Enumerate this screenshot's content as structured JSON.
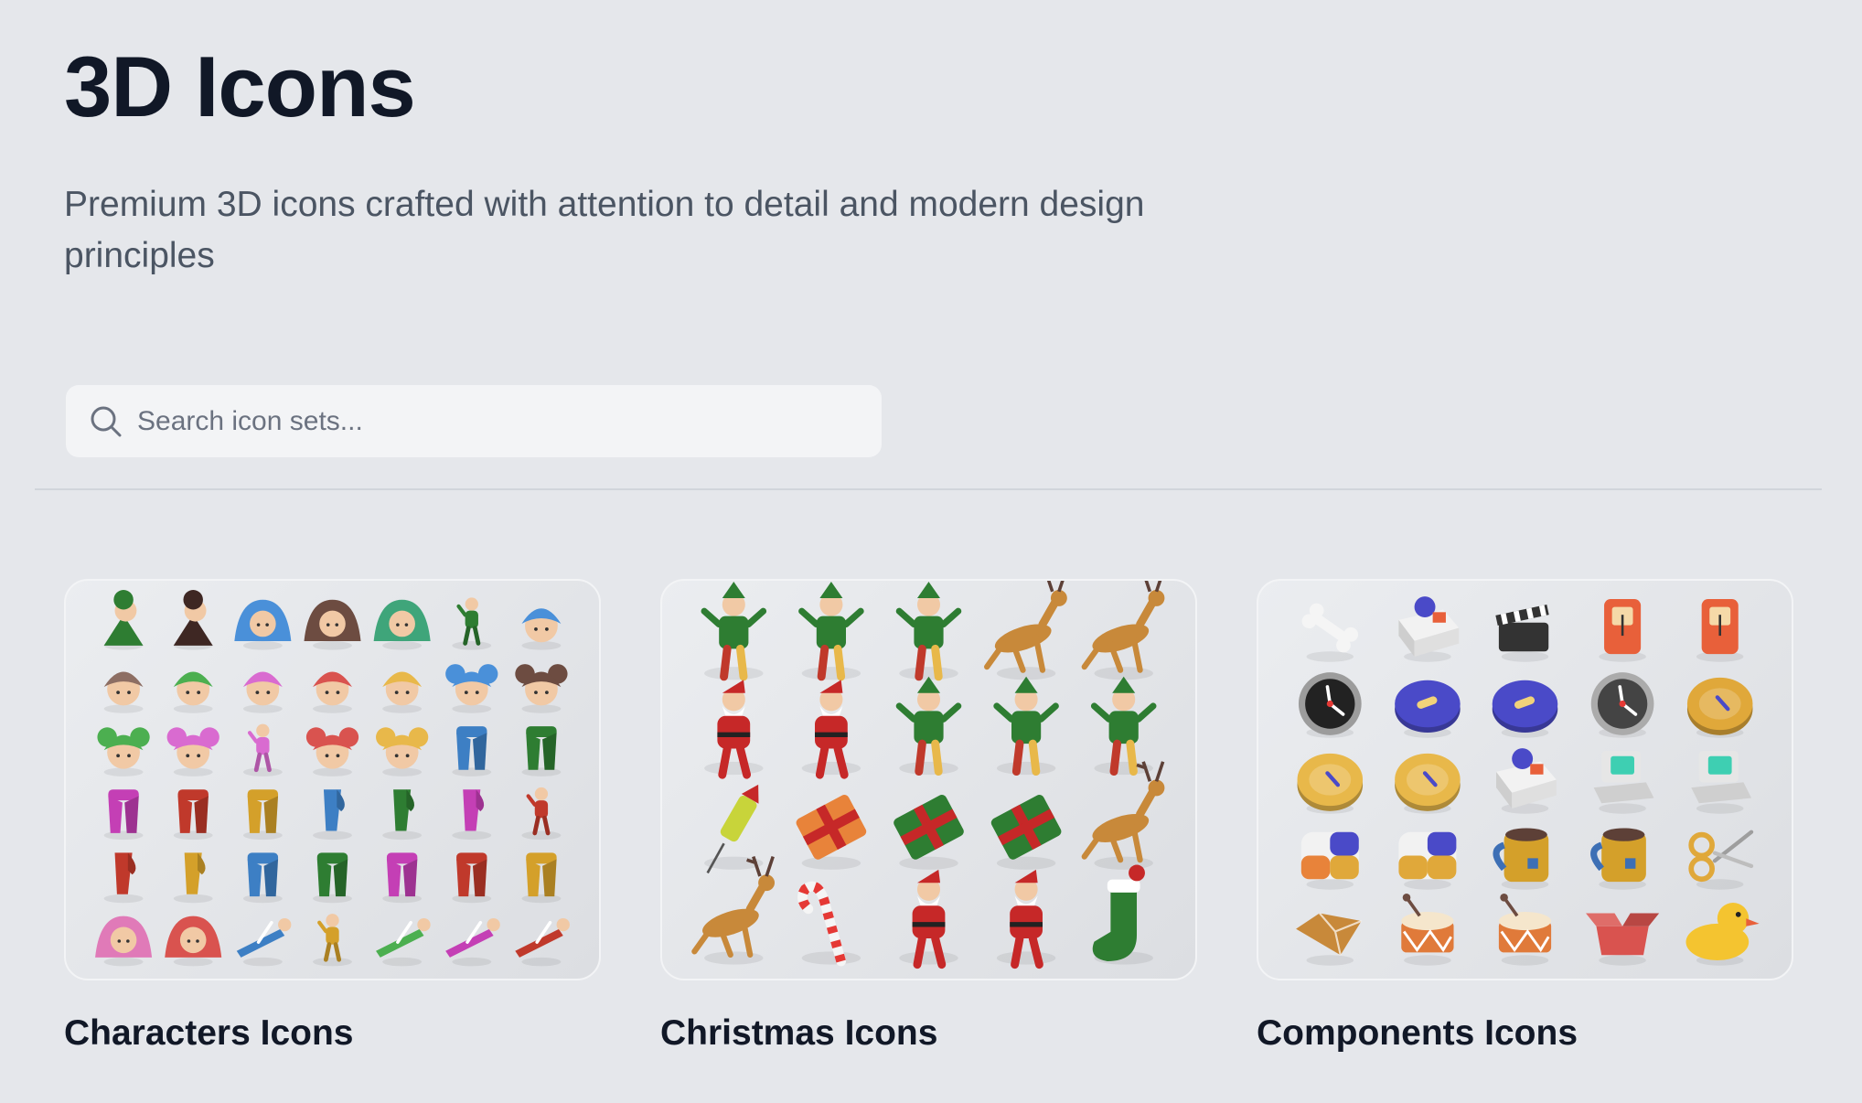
{
  "header": {
    "title": "3D Icons",
    "subtitle": "Premium 3D icons crafted with attention to detail and modern design principles"
  },
  "search": {
    "placeholder": "Search icon sets...",
    "icon": "search-icon"
  },
  "colors": {
    "background": "#e5e7eb",
    "title": "#111827",
    "subtitle": "#4b5563",
    "search_bg": "#f3f4f6"
  },
  "icon_sets": [
    {
      "name": "Characters Icons",
      "cols": 7,
      "rows": 6,
      "icons": [
        {
          "type": "elf-figure",
          "color": "#2e7d32"
        },
        {
          "type": "elf-figure",
          "color": "#3e2723"
        },
        {
          "type": "avatar",
          "color": "#4a90d9"
        },
        {
          "type": "avatar",
          "color": "#6d4c41"
        },
        {
          "type": "avatar",
          "color": "#3fa57a"
        },
        {
          "type": "figure",
          "color": "#2e7d32"
        },
        {
          "type": "head",
          "color": "#4a90d9"
        },
        {
          "type": "head",
          "color": "#8d6e63"
        },
        {
          "type": "head",
          "color": "#4caf50"
        },
        {
          "type": "head",
          "color": "#d96bd0"
        },
        {
          "type": "head",
          "color": "#d9534f"
        },
        {
          "type": "head",
          "color": "#e8b84a"
        },
        {
          "type": "bun-head",
          "color": "#4a90d9"
        },
        {
          "type": "bun-head",
          "color": "#6d4c41"
        },
        {
          "type": "bun-head",
          "color": "#4caf50"
        },
        {
          "type": "bun-head",
          "color": "#d96bd0"
        },
        {
          "type": "figure",
          "color": "#d96bd0"
        },
        {
          "type": "bun-head",
          "color": "#d9534f"
        },
        {
          "type": "bun-head",
          "color": "#e8b84a"
        },
        {
          "type": "legs",
          "color": "#3d7fc4"
        },
        {
          "type": "legs",
          "color": "#2e7d32"
        },
        {
          "type": "legs",
          "color": "#c43fb5"
        },
        {
          "type": "legs",
          "color": "#c0392b"
        },
        {
          "type": "legs",
          "color": "#d4a02a"
        },
        {
          "type": "leg",
          "color": "#3d7fc4"
        },
        {
          "type": "leg",
          "color": "#2e7d32"
        },
        {
          "type": "leg",
          "color": "#c43fb5"
        },
        {
          "type": "figure",
          "color": "#c0392b"
        },
        {
          "type": "leg",
          "color": "#c0392b"
        },
        {
          "type": "leg",
          "color": "#d4a02a"
        },
        {
          "type": "legs",
          "color": "#3d7fc4"
        },
        {
          "type": "legs",
          "color": "#2e7d32"
        },
        {
          "type": "legs",
          "color": "#c43fb5"
        },
        {
          "type": "legs",
          "color": "#c0392b"
        },
        {
          "type": "legs",
          "color": "#d4a02a"
        },
        {
          "type": "avatar",
          "color": "#e07ab8"
        },
        {
          "type": "avatar",
          "color": "#d9534f"
        },
        {
          "type": "lying",
          "color": "#3d7fc4"
        },
        {
          "type": "figure",
          "color": "#d4a02a"
        },
        {
          "type": "lying",
          "color": "#4caf50"
        },
        {
          "type": "lying",
          "color": "#c43fb5"
        },
        {
          "type": "lying",
          "color": "#c0392b"
        }
      ]
    },
    {
      "name": "Christmas Icons",
      "cols": 5,
      "rows": 4,
      "icons": [
        {
          "type": "elf",
          "color": "#2e7d32"
        },
        {
          "type": "elf",
          "color": "#2e7d32"
        },
        {
          "type": "elf",
          "color": "#2e7d32"
        },
        {
          "type": "reindeer",
          "color": "#c8893a"
        },
        {
          "type": "reindeer",
          "color": "#c8893a"
        },
        {
          "type": "santa",
          "color": "#c62828"
        },
        {
          "type": "santa",
          "color": "#c62828"
        },
        {
          "type": "elf",
          "color": "#2e7d32"
        },
        {
          "type": "elf",
          "color": "#2e7d32"
        },
        {
          "type": "elf",
          "color": "#2e7d32"
        },
        {
          "type": "firework",
          "color": "#c8d43a"
        },
        {
          "type": "gift",
          "color": "#e8833a"
        },
        {
          "type": "gift",
          "color": "#2e7d32"
        },
        {
          "type": "gift",
          "color": "#2e7d32"
        },
        {
          "type": "reindeer",
          "color": "#c8893a"
        },
        {
          "type": "reindeer",
          "color": "#c8893a"
        },
        {
          "type": "candy-cane",
          "color": "#e53935"
        },
        {
          "type": "santa",
          "color": "#c62828"
        },
        {
          "type": "santa",
          "color": "#c62828"
        },
        {
          "type": "stocking",
          "color": "#2e7d32"
        }
      ]
    },
    {
      "name": "Components Icons",
      "cols": 5,
      "rows": 5,
      "icons": [
        {
          "type": "bone",
          "color": "#f5f5f5"
        },
        {
          "type": "box",
          "color": "#f2f2f2"
        },
        {
          "type": "clapper",
          "color": "#333333"
        },
        {
          "type": "phone",
          "color": "#e8603a"
        },
        {
          "type": "phone",
          "color": "#e8603a"
        },
        {
          "type": "clock",
          "color": "#222222"
        },
        {
          "type": "button",
          "color": "#4a4ac8"
        },
        {
          "type": "button",
          "color": "#4a4ac8"
        },
        {
          "type": "clock",
          "color": "#444444"
        },
        {
          "type": "coin",
          "color": "#e0a83a"
        },
        {
          "type": "coin",
          "color": "#e8b84a"
        },
        {
          "type": "coin",
          "color": "#e8b84a"
        },
        {
          "type": "box",
          "color": "#f2f2f2"
        },
        {
          "type": "computer",
          "color": "#e6e6e6"
        },
        {
          "type": "computer",
          "color": "#e6e6e6"
        },
        {
          "type": "cube",
          "color": "#e8833a"
        },
        {
          "type": "cube",
          "color": "#e0a83a"
        },
        {
          "type": "mug",
          "color": "#d4a02a"
        },
        {
          "type": "mug",
          "color": "#d4a02a"
        },
        {
          "type": "scissors",
          "color": "#e0a83a"
        },
        {
          "type": "gem",
          "color": "#c8893a"
        },
        {
          "type": "drum",
          "color": "#e07a3a"
        },
        {
          "type": "drum",
          "color": "#e07a3a"
        },
        {
          "type": "open-box",
          "color": "#d9534f"
        },
        {
          "type": "duck",
          "color": "#f4c430"
        }
      ]
    }
  ]
}
